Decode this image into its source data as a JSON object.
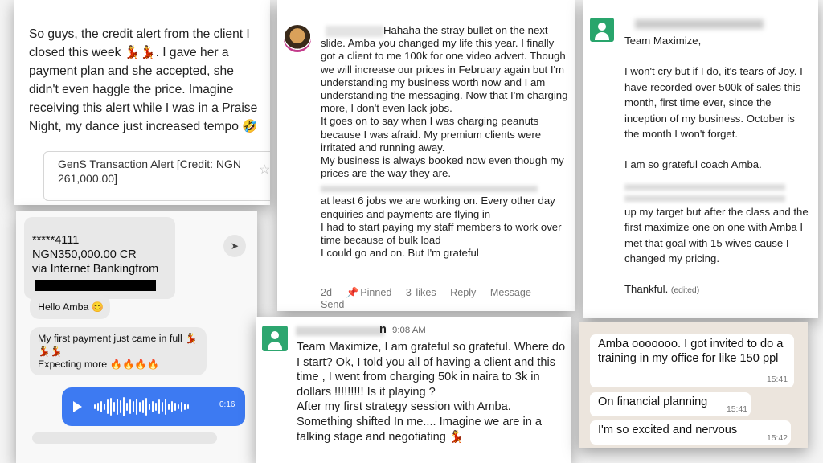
{
  "card1": {
    "message_line1": "So guys, the credit alert from the client I",
    "message_line2": "closed this week 💃💃. I gave her a",
    "message_line3": "payment plan and she accepted, she",
    "message_line4": "didn't even haggle the price. Imagine",
    "message_line5": "receiving this alert while I was in a Praise",
    "message_line6": "Night, my dance just increased tempo 🤣",
    "alert_text": "GenS Transaction Alert [Credit: NGN 261,000.00]",
    "star_icon": "star-outline-icon"
  },
  "card2": {
    "p1": "Hahaha the stray bullet on the next slide. Amba you changed my life this year. I finally got a client to me 100k for one video advert. Though we will increase our prices in February again but I'm understanding my business worth now and I am understanding the messaging. Now that I'm charging more, I don't even lack jobs.",
    "p2": "It goes on to say when I was charging peanuts because I was afraid. My premium clients were irritated and running away.",
    "p3": "My business is always booked now even though my prices are the way they are.",
    "p4": "at least 6 jobs we are working on. Every other day enquiries and payments are flying in",
    "p5": "I had to start paying my staff members to work over time because of bulk load",
    "p6": "I could go and on. But I'm grateful",
    "meta_age": "2d",
    "meta_pinned": "Pinned",
    "meta_likes": "3 likes",
    "meta_reply": "Reply",
    "meta_message": "Message",
    "meta_send": "Send"
  },
  "card3": {
    "greeting": "Team Maximize,",
    "p1": "I won't cry but if I do, it's tears of Joy. I have recorded over 500k of sales this month, first time ever, since the inception of my business. October is the month I won't forget.",
    "p2": "I am so grateful coach Amba.",
    "p3": "up my target but after the class and the first maximize one on one with Amba I met that goal with 15 wives cause I changed my pricing.",
    "closing": "Thankful.",
    "edited": "(edited)"
  },
  "card4": {
    "bank_line1": "*****4111",
    "bank_line2": "NGN350,000.00 CR",
    "bank_line3": "via Internet Bankingfrom",
    "msg1": "Hello Amba 😊",
    "msg2_line1": "My first payment just came in full 💃",
    "msg2_line2": "💃💃",
    "msg2_line3": "Expecting more 🔥🔥🔥🔥",
    "voice_duration": "0:16"
  },
  "card5": {
    "name_suffix": "n",
    "time": "9:08 AM",
    "p1": "Team Maximize, I am grateful so grateful. Where do I start? Ok, I told you all of having a client and this time , I went from charging 50k in naira to 3k in dollars !!!!!!!!! Is it playing ?",
    "p2": "After my first strategy session with Amba. Something shifted In me....  Imagine we are in a talking stage and negotiating 💃"
  },
  "card6": {
    "msg1": "Amba ooooooo. I got invited to do a training in my office for like 150 ppl",
    "msg1_time": "15:41",
    "msg2": "On financial planning",
    "msg2_time": "15:41",
    "msg3": "I'm so excited and nervous",
    "msg3_time": "15:42"
  }
}
